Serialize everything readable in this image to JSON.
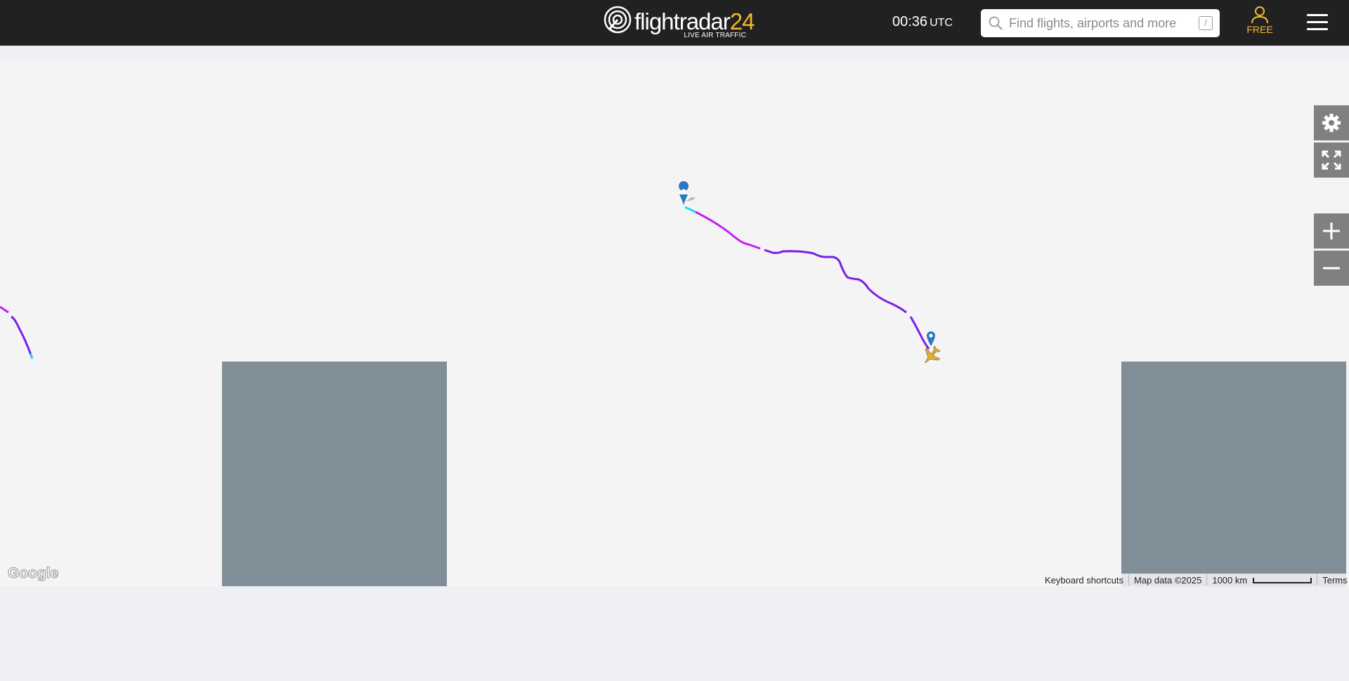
{
  "header": {
    "logo_text": "flightradar",
    "logo_number": "24",
    "logo_subtitle": "LIVE AIR TRAFFIC",
    "time": "00:36",
    "timezone": "UTC",
    "search_placeholder": "Find flights, airports and more",
    "search_shortcut": "/",
    "user_label": "FREE",
    "accent_color": "#f5b82e"
  },
  "map_controls": {
    "settings_icon": "gear-icon",
    "fullscreen_icon": "expand-icon",
    "zoom_in_icon": "plus-icon",
    "zoom_out_icon": "minus-icon"
  },
  "map": {
    "track_color_primary": "#7a1fe8",
    "track_color_secondary": "#c61ef5",
    "track_color_start": "#2bd4f5",
    "pin_color": "#2a78c2",
    "aircraft_color": "#e0b23c",
    "tile_color": "#808e97"
  },
  "footer": {
    "google_label": "Google",
    "keyboard_shortcuts": "Keyboard shortcuts",
    "map_data": "Map data ©2025",
    "scale": "1000 km",
    "terms": "Terms"
  }
}
